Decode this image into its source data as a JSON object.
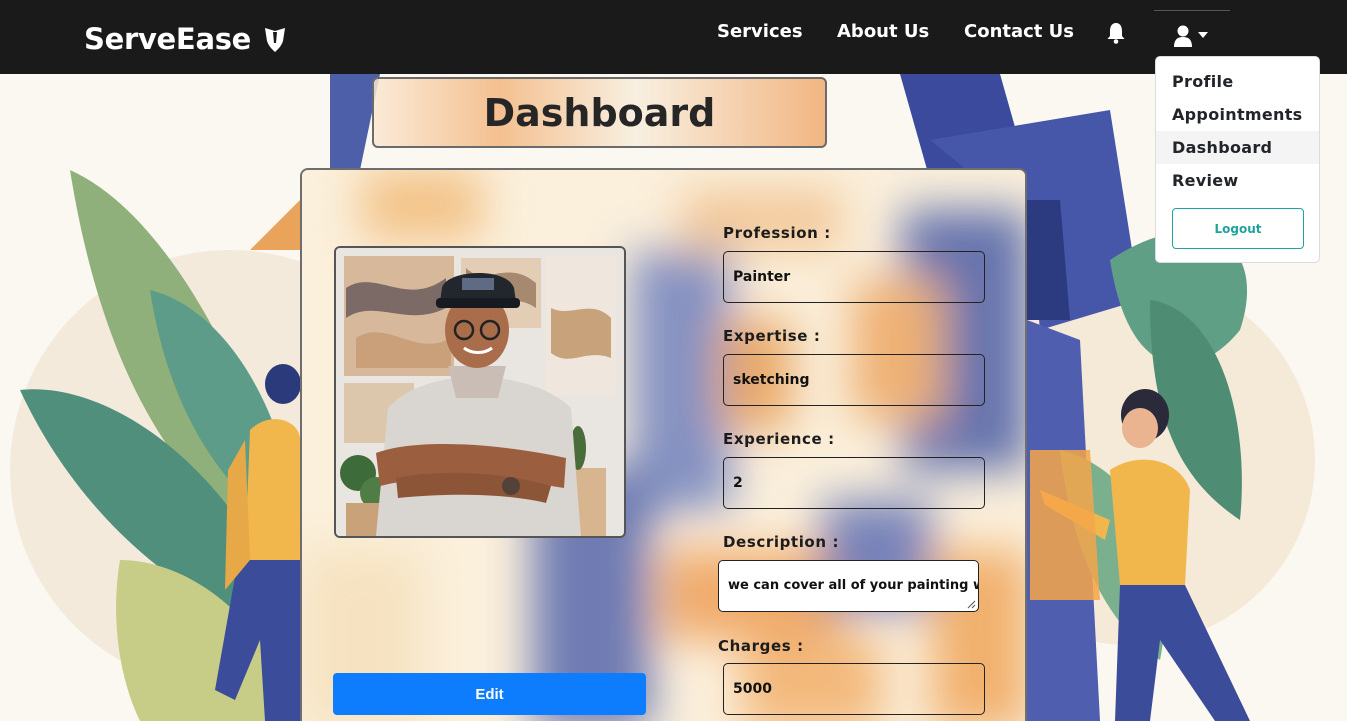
{
  "app": {
    "brand": "ServeEase"
  },
  "nav": {
    "links": [
      "Services",
      "About Us",
      "Contact Us"
    ]
  },
  "user_menu": {
    "items": [
      "Profile",
      "Appointments",
      "Dashboard",
      "Review"
    ],
    "active_item": "Dashboard",
    "logout_label": "Logout"
  },
  "page": {
    "title": "Dashboard"
  },
  "form": {
    "profession_label": "Profession :",
    "profession_value": "Painter",
    "expertise_label": "Expertise :",
    "expertise_value": "sketching",
    "experience_label": "Experience :",
    "experience_value": "2",
    "description_label": "Description :",
    "description_value": "we can cover all of your painting work",
    "charges_label": "Charges :",
    "charges_value": "5000",
    "edit_label": "Edit"
  },
  "colors": {
    "navbar": "#1b1a1a",
    "primary_button": "#0d7dfd",
    "logout_accent": "#20a39e"
  },
  "icons": [
    "brand-logo-icon",
    "bell-icon",
    "user-icon",
    "caret-down-icon",
    "resize-grip-icon"
  ]
}
